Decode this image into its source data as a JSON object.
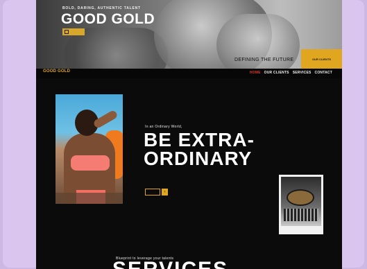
{
  "hero": {
    "kicker": "BOLD, DARING, AUTHENTIC TALENT",
    "title": "GOOD GOLD",
    "defining": "DEFINING THE FUTURE",
    "cta": "OUR CLIENTS"
  },
  "nav": {
    "logo": "GOOD GOLD",
    "items": [
      {
        "label": "HOME",
        "active": true
      },
      {
        "label": "OUR CLIENTS",
        "active": false
      },
      {
        "label": "SERVICES",
        "active": false
      },
      {
        "label": "CONTACT",
        "active": false
      }
    ]
  },
  "main": {
    "intro": "In an Ordinary World,",
    "headline_line1": "BE EXTRA-",
    "headline_line2": "ORDINARY",
    "contact_arrow": "›"
  },
  "services": {
    "kicker": "Blueprint to leverage your talents",
    "title": "SERVICES"
  },
  "colors": {
    "gold": "#e0a61f",
    "active_nav": "#d43b2e",
    "background": "#0b0b0b",
    "frame": "#cdb8e3"
  }
}
